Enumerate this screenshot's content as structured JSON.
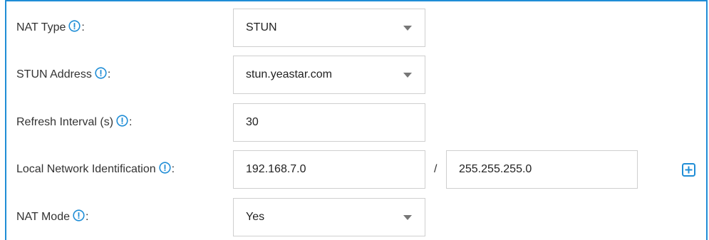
{
  "form": {
    "nat_type": {
      "label": "NAT Type",
      "colon": ":",
      "value": "STUN"
    },
    "stun_address": {
      "label": "STUN Address",
      "colon": ":",
      "value": "stun.yeastar.com"
    },
    "refresh_interval": {
      "label": "Refresh Interval (s)",
      "colon": ":",
      "value": "30"
    },
    "local_network": {
      "label": "Local Network Identification",
      "colon": ":",
      "ip_value": "192.168.7.0",
      "separator": "/",
      "mask_value": "255.255.255.0"
    },
    "nat_mode": {
      "label": "NAT Mode",
      "colon": ":",
      "value": "Yes"
    }
  },
  "icons": {
    "info": "info-circle-icon",
    "add": "plus-square-icon"
  },
  "colors": {
    "accent": "#1f8dd6",
    "border": "#cfcfcf",
    "text": "#333333"
  }
}
